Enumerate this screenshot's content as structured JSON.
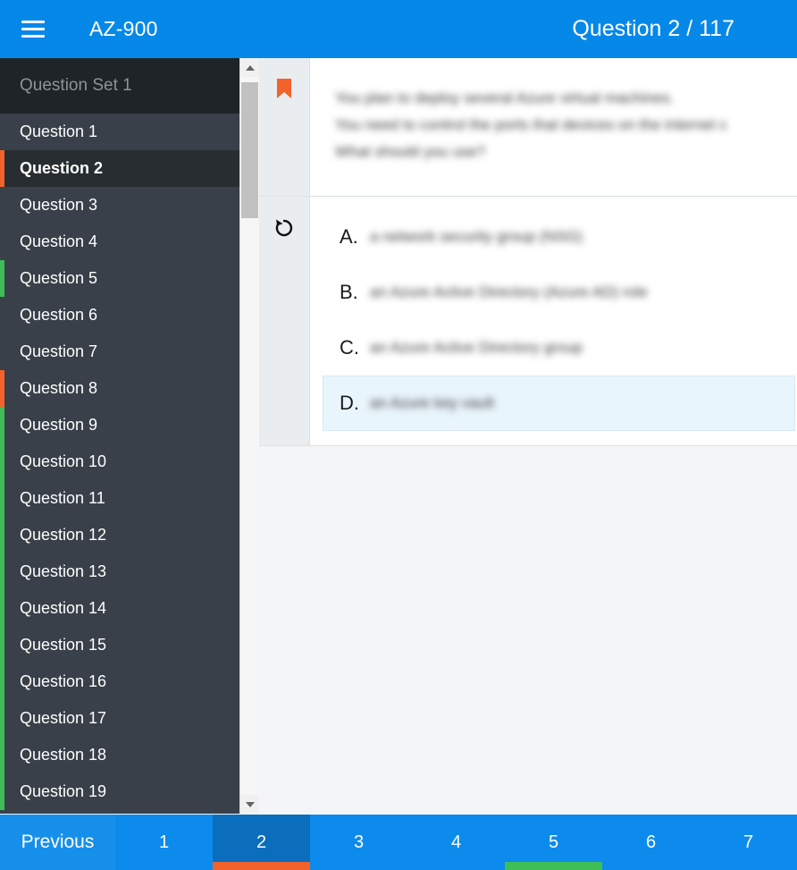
{
  "header": {
    "menu_icon": "hamburger-icon",
    "app_title": "AZ-900",
    "question_counter": "Question 2 / 117"
  },
  "sidebar": {
    "set_title": "Question Set 1",
    "items": [
      {
        "label": "Question 1",
        "active": false,
        "marker": ""
      },
      {
        "label": "Question 2",
        "active": true,
        "marker": "#f3622b"
      },
      {
        "label": "Question 3",
        "active": false,
        "marker": ""
      },
      {
        "label": "Question 4",
        "active": false,
        "marker": ""
      },
      {
        "label": "Question 5",
        "active": false,
        "marker": "#3fbd57"
      },
      {
        "label": "Question 6",
        "active": false,
        "marker": ""
      },
      {
        "label": "Question 7",
        "active": false,
        "marker": ""
      },
      {
        "label": "Question 8",
        "active": false,
        "marker": "#f3622b"
      },
      {
        "label": "Question 9",
        "active": false,
        "marker": "#3fbd57"
      },
      {
        "label": "Question 10",
        "active": false,
        "marker": "#3fbd57"
      },
      {
        "label": "Question 11",
        "active": false,
        "marker": "#3fbd57"
      },
      {
        "label": "Question 12",
        "active": false,
        "marker": "#3fbd57"
      },
      {
        "label": "Question 13",
        "active": false,
        "marker": "#3fbd57"
      },
      {
        "label": "Question 14",
        "active": false,
        "marker": "#3fbd57"
      },
      {
        "label": "Question 15",
        "active": false,
        "marker": "#3fbd57"
      },
      {
        "label": "Question 16",
        "active": false,
        "marker": "#3fbd57"
      },
      {
        "label": "Question 17",
        "active": false,
        "marker": "#3fbd57"
      },
      {
        "label": "Question 18",
        "active": false,
        "marker": "#3fbd57"
      },
      {
        "label": "Question 19",
        "active": false,
        "marker": "#3fbd57"
      }
    ],
    "scrollbar": {
      "up_icon": "scroll-up-arrow-icon",
      "down_icon": "scroll-down-arrow-icon"
    }
  },
  "question_panel": {
    "bookmark_icon": "bookmark-icon",
    "bookmark_color": "#f3622b",
    "reset_icon": "reset-arrow-icon",
    "question_lines": [
      "You plan to deploy several Azure virtual machines.",
      "You need to control the ports that devices on the internet c",
      "What should you use?"
    ],
    "options": [
      {
        "letter": "A.",
        "text": "a network security group (NSG)",
        "selected": false
      },
      {
        "letter": "B.",
        "text": "an Azure Active Directory (Azure AD) role",
        "selected": false
      },
      {
        "letter": "C.",
        "text": "an Azure Active Directory group",
        "selected": false
      },
      {
        "letter": "D.",
        "text": "an Azure key vault",
        "selected": true
      }
    ]
  },
  "pagination": {
    "previous_label": "Previous",
    "pages": [
      {
        "label": "1",
        "active": false,
        "underline": ""
      },
      {
        "label": "2",
        "active": true,
        "underline": "#f3622b"
      },
      {
        "label": "3",
        "active": false,
        "underline": ""
      },
      {
        "label": "4",
        "active": false,
        "underline": ""
      },
      {
        "label": "5",
        "active": false,
        "underline": "#3fbd57"
      },
      {
        "label": "6",
        "active": false,
        "underline": ""
      },
      {
        "label": "7",
        "active": false,
        "underline": ""
      }
    ]
  },
  "colors": {
    "header_blue": "#0688e8",
    "sidebar_bg": "#394049",
    "sidebar_active": "#282d31",
    "set_header_bg": "#1f2429",
    "marker_orange": "#f3622b",
    "marker_green": "#3fbd57",
    "selected_option_bg": "#e9f5fc",
    "page_active_bg": "#0a6ebd"
  }
}
